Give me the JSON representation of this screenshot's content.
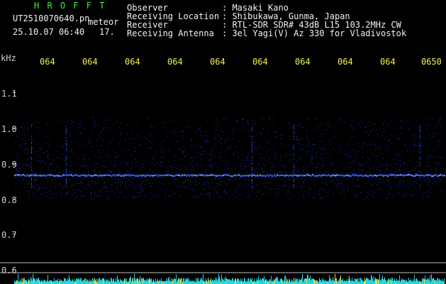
{
  "header": {
    "title": "H R O F F T",
    "filename": "UT2510070640.pn",
    "mode": "meteor",
    "datetime": "25.10.07 06:40",
    "counter": "17.",
    "fields": [
      {
        "label": "Observer",
        "value": ": Masaki Kano"
      },
      {
        "label": "Receiving Location",
        "value": ": Shibukawa, Gunma, Japan"
      },
      {
        "label": "Receiver",
        "value": ": RTL-SDR SDR# 43dB L15 103.2MHz CW"
      },
      {
        "label": "Receiving Antenna",
        "value": ": 3el Yagi(V) Az 330 for Vladivostok"
      }
    ]
  },
  "axis": {
    "unit_label": "kHz",
    "time_ticks": [
      "064",
      "064",
      "064",
      "064",
      "064",
      "064",
      "064",
      "064",
      "064",
      "0650"
    ],
    "freq_ticks": [
      "1.1",
      "1.0",
      "0.9",
      "0.8",
      "0.7",
      "0.6"
    ]
  },
  "colors": {
    "header_title": "#3cf03c",
    "header_text": "#f2f2f2",
    "time_ticks": "#f0f050",
    "freq_ticks": "#cfcfcf",
    "signal": "#3a6bff",
    "bottom_bar": "#28e0e8"
  }
}
